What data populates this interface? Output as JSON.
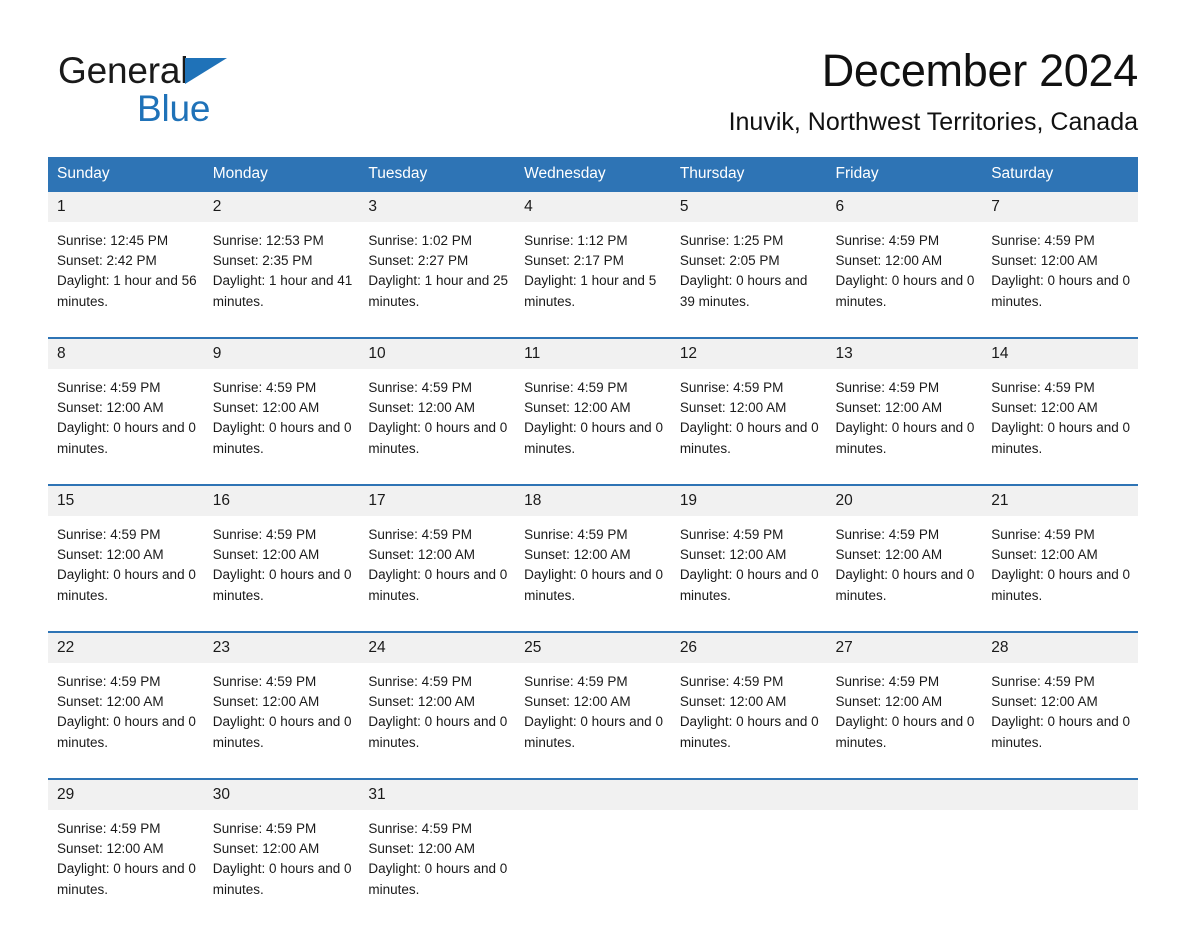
{
  "brand": {
    "name_part1": "General",
    "name_part2": "Blue",
    "logo_icon": "triangle-icon",
    "color_primary": "#1f72b8"
  },
  "header": {
    "title": "December 2024",
    "subtitle": "Inuvik, Northwest Territories, Canada"
  },
  "theme": {
    "header_blue": "#2e74b5",
    "daynum_gray": "#f1f1f1",
    "text": "#1a1a1a"
  },
  "calendar": {
    "weekday_headers": [
      "Sunday",
      "Monday",
      "Tuesday",
      "Wednesday",
      "Thursday",
      "Friday",
      "Saturday"
    ],
    "weeks": [
      [
        {
          "day": "1",
          "sunrise": "Sunrise: 12:45 PM",
          "sunset": "Sunset: 2:42 PM",
          "daylight": "Daylight: 1 hour and 56 minutes."
        },
        {
          "day": "2",
          "sunrise": "Sunrise: 12:53 PM",
          "sunset": "Sunset: 2:35 PM",
          "daylight": "Daylight: 1 hour and 41 minutes."
        },
        {
          "day": "3",
          "sunrise": "Sunrise: 1:02 PM",
          "sunset": "Sunset: 2:27 PM",
          "daylight": "Daylight: 1 hour and 25 minutes."
        },
        {
          "day": "4",
          "sunrise": "Sunrise: 1:12 PM",
          "sunset": "Sunset: 2:17 PM",
          "daylight": "Daylight: 1 hour and 5 minutes."
        },
        {
          "day": "5",
          "sunrise": "Sunrise: 1:25 PM",
          "sunset": "Sunset: 2:05 PM",
          "daylight": "Daylight: 0 hours and 39 minutes."
        },
        {
          "day": "6",
          "sunrise": "Sunrise: 4:59 PM",
          "sunset": "Sunset: 12:00 AM",
          "daylight": "Daylight: 0 hours and 0 minutes."
        },
        {
          "day": "7",
          "sunrise": "Sunrise: 4:59 PM",
          "sunset": "Sunset: 12:00 AM",
          "daylight": "Daylight: 0 hours and 0 minutes."
        }
      ],
      [
        {
          "day": "8",
          "sunrise": "Sunrise: 4:59 PM",
          "sunset": "Sunset: 12:00 AM",
          "daylight": "Daylight: 0 hours and 0 minutes."
        },
        {
          "day": "9",
          "sunrise": "Sunrise: 4:59 PM",
          "sunset": "Sunset: 12:00 AM",
          "daylight": "Daylight: 0 hours and 0 minutes."
        },
        {
          "day": "10",
          "sunrise": "Sunrise: 4:59 PM",
          "sunset": "Sunset: 12:00 AM",
          "daylight": "Daylight: 0 hours and 0 minutes."
        },
        {
          "day": "11",
          "sunrise": "Sunrise: 4:59 PM",
          "sunset": "Sunset: 12:00 AM",
          "daylight": "Daylight: 0 hours and 0 minutes."
        },
        {
          "day": "12",
          "sunrise": "Sunrise: 4:59 PM",
          "sunset": "Sunset: 12:00 AM",
          "daylight": "Daylight: 0 hours and 0 minutes."
        },
        {
          "day": "13",
          "sunrise": "Sunrise: 4:59 PM",
          "sunset": "Sunset: 12:00 AM",
          "daylight": "Daylight: 0 hours and 0 minutes."
        },
        {
          "day": "14",
          "sunrise": "Sunrise: 4:59 PM",
          "sunset": "Sunset: 12:00 AM",
          "daylight": "Daylight: 0 hours and 0 minutes."
        }
      ],
      [
        {
          "day": "15",
          "sunrise": "Sunrise: 4:59 PM",
          "sunset": "Sunset: 12:00 AM",
          "daylight": "Daylight: 0 hours and 0 minutes."
        },
        {
          "day": "16",
          "sunrise": "Sunrise: 4:59 PM",
          "sunset": "Sunset: 12:00 AM",
          "daylight": "Daylight: 0 hours and 0 minutes."
        },
        {
          "day": "17",
          "sunrise": "Sunrise: 4:59 PM",
          "sunset": "Sunset: 12:00 AM",
          "daylight": "Daylight: 0 hours and 0 minutes."
        },
        {
          "day": "18",
          "sunrise": "Sunrise: 4:59 PM",
          "sunset": "Sunset: 12:00 AM",
          "daylight": "Daylight: 0 hours and 0 minutes."
        },
        {
          "day": "19",
          "sunrise": "Sunrise: 4:59 PM",
          "sunset": "Sunset: 12:00 AM",
          "daylight": "Daylight: 0 hours and 0 minutes."
        },
        {
          "day": "20",
          "sunrise": "Sunrise: 4:59 PM",
          "sunset": "Sunset: 12:00 AM",
          "daylight": "Daylight: 0 hours and 0 minutes."
        },
        {
          "day": "21",
          "sunrise": "Sunrise: 4:59 PM",
          "sunset": "Sunset: 12:00 AM",
          "daylight": "Daylight: 0 hours and 0 minutes."
        }
      ],
      [
        {
          "day": "22",
          "sunrise": "Sunrise: 4:59 PM",
          "sunset": "Sunset: 12:00 AM",
          "daylight": "Daylight: 0 hours and 0 minutes."
        },
        {
          "day": "23",
          "sunrise": "Sunrise: 4:59 PM",
          "sunset": "Sunset: 12:00 AM",
          "daylight": "Daylight: 0 hours and 0 minutes."
        },
        {
          "day": "24",
          "sunrise": "Sunrise: 4:59 PM",
          "sunset": "Sunset: 12:00 AM",
          "daylight": "Daylight: 0 hours and 0 minutes."
        },
        {
          "day": "25",
          "sunrise": "Sunrise: 4:59 PM",
          "sunset": "Sunset: 12:00 AM",
          "daylight": "Daylight: 0 hours and 0 minutes."
        },
        {
          "day": "26",
          "sunrise": "Sunrise: 4:59 PM",
          "sunset": "Sunset: 12:00 AM",
          "daylight": "Daylight: 0 hours and 0 minutes."
        },
        {
          "day": "27",
          "sunrise": "Sunrise: 4:59 PM",
          "sunset": "Sunset: 12:00 AM",
          "daylight": "Daylight: 0 hours and 0 minutes."
        },
        {
          "day": "28",
          "sunrise": "Sunrise: 4:59 PM",
          "sunset": "Sunset: 12:00 AM",
          "daylight": "Daylight: 0 hours and 0 minutes."
        }
      ],
      [
        {
          "day": "29",
          "sunrise": "Sunrise: 4:59 PM",
          "sunset": "Sunset: 12:00 AM",
          "daylight": "Daylight: 0 hours and 0 minutes."
        },
        {
          "day": "30",
          "sunrise": "Sunrise: 4:59 PM",
          "sunset": "Sunset: 12:00 AM",
          "daylight": "Daylight: 0 hours and 0 minutes."
        },
        {
          "day": "31",
          "sunrise": "Sunrise: 4:59 PM",
          "sunset": "Sunset: 12:00 AM",
          "daylight": "Daylight: 0 hours and 0 minutes."
        },
        {
          "day": "",
          "sunrise": "",
          "sunset": "",
          "daylight": ""
        },
        {
          "day": "",
          "sunrise": "",
          "sunset": "",
          "daylight": ""
        },
        {
          "day": "",
          "sunrise": "",
          "sunset": "",
          "daylight": ""
        },
        {
          "day": "",
          "sunrise": "",
          "sunset": "",
          "daylight": ""
        }
      ]
    ]
  }
}
